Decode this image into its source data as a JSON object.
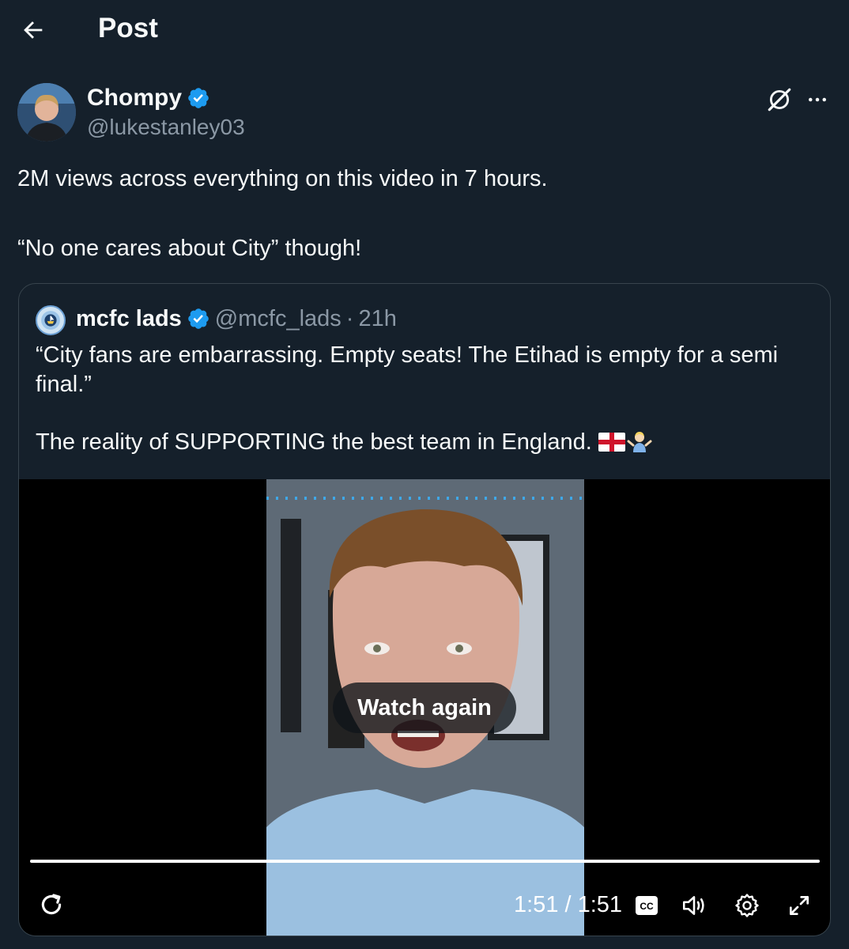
{
  "header": {
    "title": "Post"
  },
  "post": {
    "author_name": "Chompy",
    "author_handle": "@lukestanley03",
    "text_lines": [
      "2M views across everything on this video in 7 hours.",
      "“No one cares about City” though!"
    ]
  },
  "quote": {
    "author_name": "mcfc lads",
    "author_handle": "@mcfc_lads",
    "separator": "·",
    "time": "21h",
    "paragraphs": [
      "“City fans are embarrassing. Empty seats! The Etihad is empty for a semi final.”",
      "The reality of SUPPORTING the best team in England."
    ]
  },
  "video": {
    "overlay_label": "Watch again",
    "time_display": "1:51 / 1:51",
    "progress": 1.0,
    "captions_label": "CC"
  },
  "colors": {
    "background": "#15202b",
    "text": "#f7f9f9",
    "secondary": "#8b98a5",
    "border": "#38444d",
    "verified": "#1d9bf0"
  },
  "icons": [
    "back-arrow-icon",
    "verified-badge-icon",
    "grok-icon",
    "more-icon",
    "flag-england-icon",
    "person-shrugging-icon",
    "replay-icon",
    "captions-icon",
    "volume-icon",
    "settings-icon",
    "fullscreen-icon"
  ]
}
